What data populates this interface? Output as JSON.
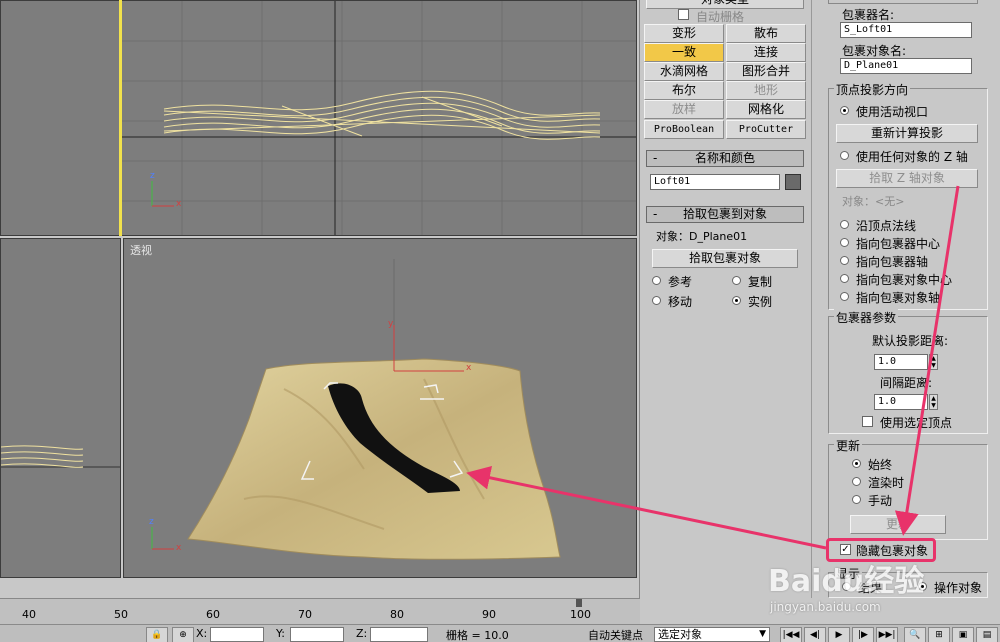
{
  "viewports": {
    "perspective_label": "透视"
  },
  "compound": {
    "top_cut_label": "对象类型",
    "auto_grid_label": "自动栅格",
    "buttons": [
      "变形",
      "散布",
      "一致",
      "连接",
      "水滴网格",
      "图形合并",
      "布尔",
      "地形",
      "放样",
      "网格化",
      "ProBoolean",
      "ProCutter"
    ]
  },
  "name_color": {
    "title": "名称和颜色",
    "name_value": "Loft01",
    "swatch_color": "#6a6a6a"
  },
  "pick_wrapper": {
    "title": "拾取包裹到对象",
    "object_label": "对象：D_Plane01",
    "pick_button": "拾取包裹对象",
    "reference": "参考",
    "copy": "复制",
    "move": "移动",
    "instance": "实例"
  },
  "params": {
    "wrapper_name_label": "包裹器名:",
    "wrapper_name_value": "S_Loft01",
    "wrap_object_name_label": "包裹对象名:",
    "wrap_object_name_value": "D_Plane01",
    "vertex_proj_title": "顶点投影方向",
    "use_active_viewport": "使用活动视口",
    "recalc_projection": "重新计算投影",
    "use_any_object_z": "使用任何对象的 Z 轴",
    "pick_z_axis_object": "拾取 Z 轴对象",
    "object_none": "对象：<无>",
    "along_vertex_normals": "沿顶点法线",
    "toward_wrapper_center": "指向包裹器中心",
    "toward_wrapper_pivot": "指向包裹器轴",
    "toward_wrapped_center": "指向包裹对象中心",
    "toward_wrapped_pivot": "指向包裹对象轴",
    "wrapper_params_title": "包裹器参数",
    "default_proj_distance_label": "默认投影距离:",
    "default_proj_distance_value": "1.0",
    "standoff_distance_label": "间隔距离:",
    "standoff_distance_value": "1.0",
    "use_selected_vertices": "使用选定顶点",
    "update_title": "更新",
    "always": "始终",
    "when_rendering": "渲染时",
    "manually": "手动",
    "update_button": "更新",
    "hide_wrap_object": "隐藏包裹对象",
    "display_title": "显示",
    "result": "结果",
    "operands": "操作对象"
  },
  "timeline": {
    "ticks": [
      "40",
      "50",
      "60",
      "70",
      "80",
      "90",
      "100"
    ]
  },
  "status_bar": {
    "x_label": "X:",
    "y_label": "Y:",
    "z_label": "Z:",
    "grid_text": "栅格 = 10.0",
    "auto_key_label": "自动关键点",
    "selection_value": "选定对象"
  },
  "watermark": {
    "brand": "Baidu经验",
    "url": "jingyan.baidu.com"
  },
  "annotation_color": "#e8336a"
}
